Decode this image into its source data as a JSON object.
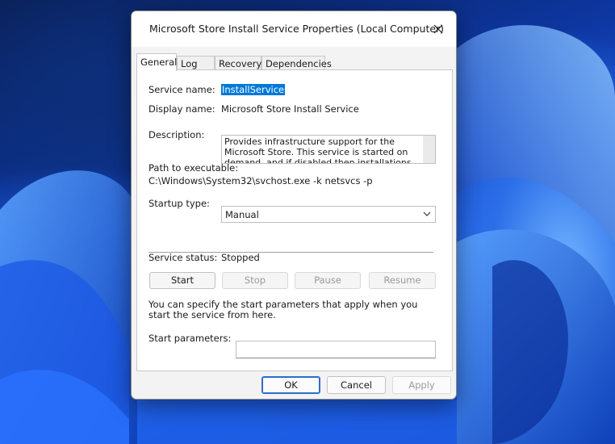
{
  "dialog": {
    "title": "Microsoft Store Install Service Properties (Local Computer)"
  },
  "tabs": [
    {
      "label": "General",
      "active": true
    },
    {
      "label": "Log On",
      "active": false
    },
    {
      "label": "Recovery",
      "active": false
    },
    {
      "label": "Dependencies",
      "active": false
    }
  ],
  "general": {
    "service_name_label": "Service name:",
    "service_name_value": "InstallService",
    "display_name_label": "Display name:",
    "display_name_value": "Microsoft Store Install Service",
    "description_label": "Description:",
    "description_value": "Provides infrastructure support for the Microsoft Store. This service is started on demand, and if disabled then installations will not function properly.",
    "path_label": "Path to executable:",
    "path_value": "C:\\Windows\\System32\\svchost.exe -k netsvcs -p",
    "startup_type_label": "Startup type:",
    "startup_type_value": "Manual",
    "service_status_label": "Service status:",
    "service_status_value": "Stopped",
    "start_button": "Start",
    "stop_button": "Stop",
    "pause_button": "Pause",
    "resume_button": "Resume",
    "start_params_hint": "You can specify the start parameters that apply when you start the service from here.",
    "start_params_label": "Start parameters:",
    "start_params_value": ""
  },
  "footer": {
    "ok": "OK",
    "cancel": "Cancel",
    "apply": "Apply"
  },
  "colors": {
    "accent": "#0078d7",
    "wallpaper": "#1c58e0"
  }
}
